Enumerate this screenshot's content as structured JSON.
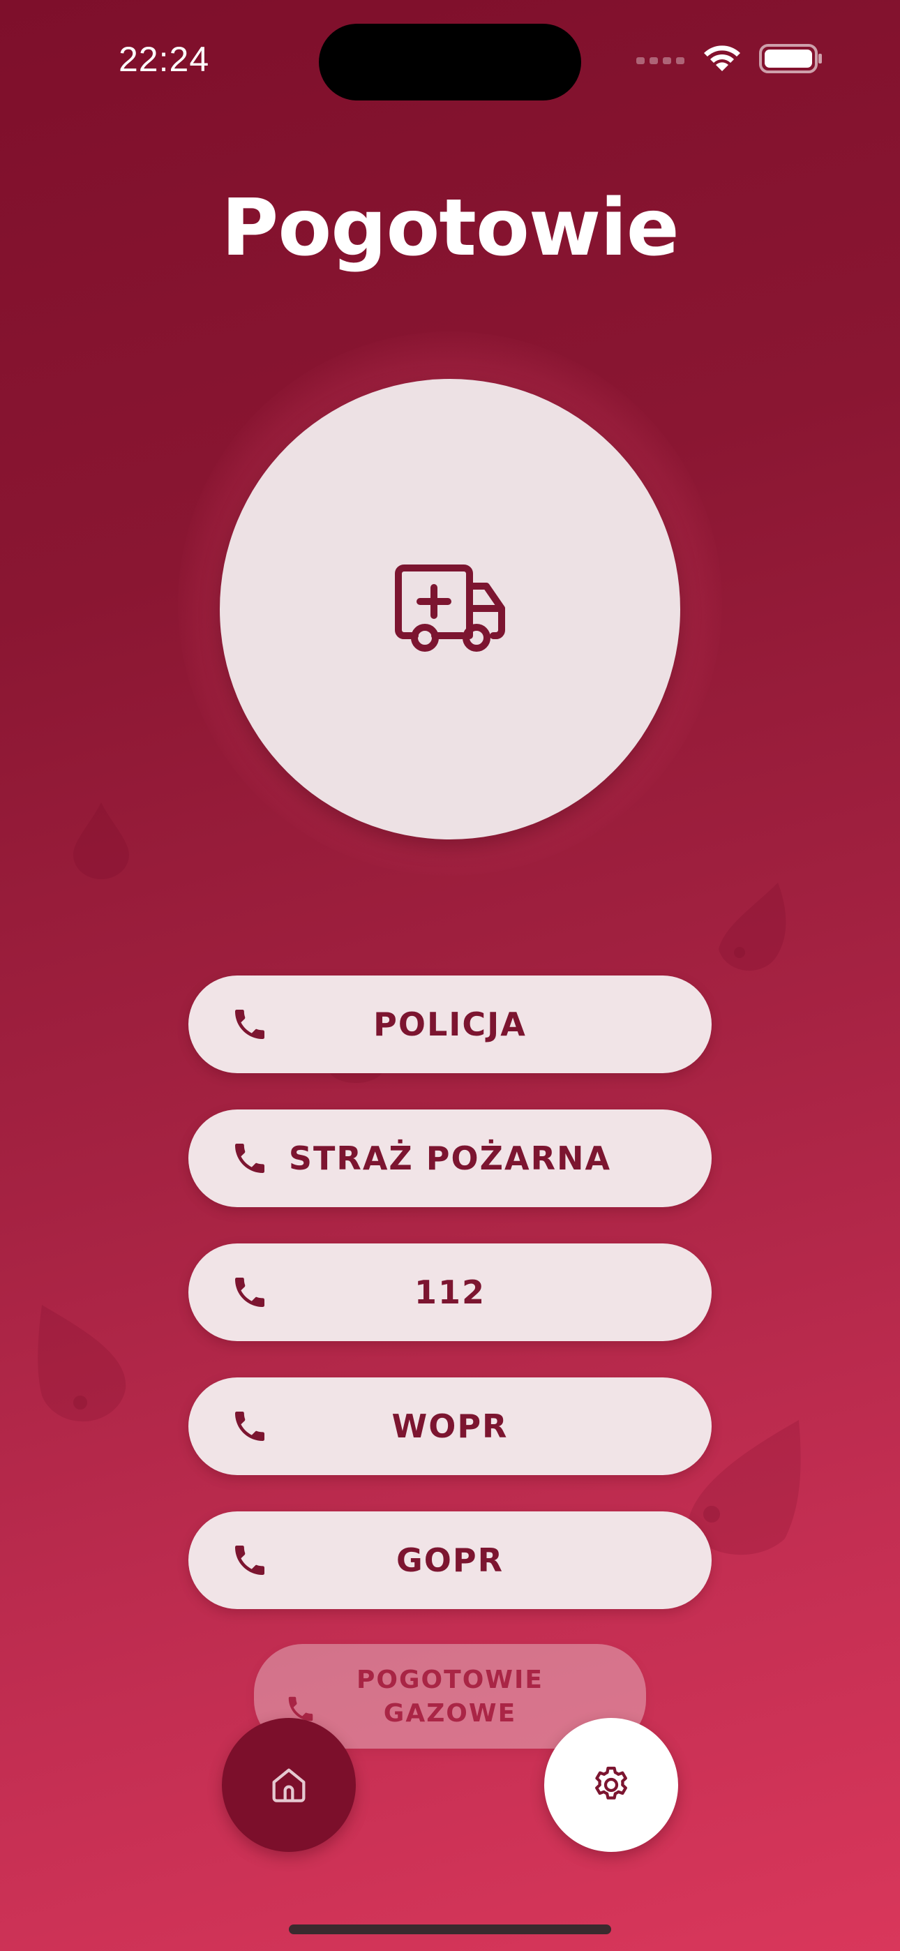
{
  "status_bar": {
    "time": "22:24"
  },
  "header": {
    "title": "Pogotowie"
  },
  "hero": {
    "icon": "ambulance-icon"
  },
  "emergency_buttons": [
    {
      "label": "POLICJA",
      "icon": "phone-icon"
    },
    {
      "label": "STRAŻ POŻARNA",
      "icon": "phone-icon"
    },
    {
      "label": "112",
      "icon": "phone-icon"
    },
    {
      "label": "WOPR",
      "icon": "phone-icon"
    },
    {
      "label": "GOPR",
      "icon": "phone-icon"
    },
    {
      "label": "POGOTOWIE GAZOWE",
      "icon": "phone-icon"
    }
  ],
  "bottom_nav": {
    "home_icon": "home-icon",
    "settings_icon": "gear-icon"
  },
  "colors": {
    "accent": "#7c1530",
    "button_bg": "#f1e4e7",
    "circle_bg": "#ede1e4"
  }
}
